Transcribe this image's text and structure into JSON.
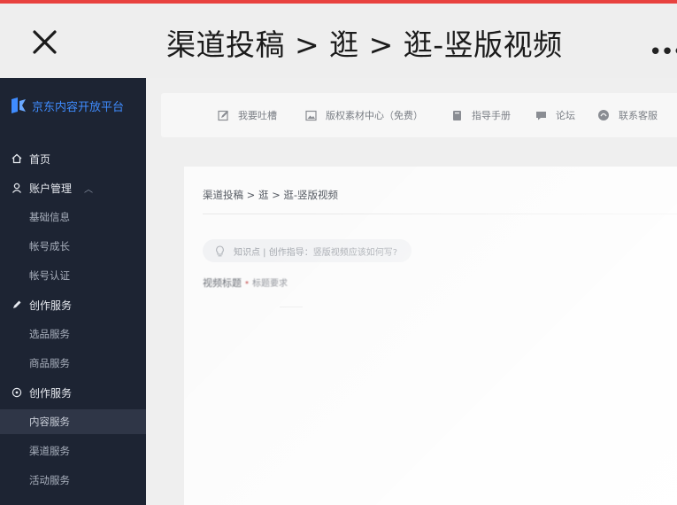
{
  "header": {
    "title": "渠道投稿 > 逛 > 逛-竖版视频",
    "more": "•••"
  },
  "sidebar": {
    "logo_text": "京东内容开放平台",
    "items": [
      {
        "label": "首页",
        "icon": "home-icon",
        "level": 1
      },
      {
        "label": "账户管理",
        "icon": "user-icon",
        "level": 1,
        "expanded": true
      },
      {
        "label": "基础信息",
        "level": 2
      },
      {
        "label": "帐号成长",
        "level": 2
      },
      {
        "label": "帐号认证",
        "level": 2
      },
      {
        "label": "创作服务",
        "icon": "pen-icon",
        "level": 1
      },
      {
        "label": "选品服务",
        "level": 2
      },
      {
        "label": "商品服务",
        "level": 2
      },
      {
        "label": "创作服务",
        "icon": "target-icon",
        "level": 1
      },
      {
        "label": "内容服务",
        "level": 2,
        "active": true
      },
      {
        "label": "渠道服务",
        "level": 2
      },
      {
        "label": "活动服务",
        "level": 2
      }
    ]
  },
  "toolbar": {
    "items": [
      {
        "label": "我要吐槽",
        "icon": "edit-icon"
      },
      {
        "label": "版权素材中心（免费）",
        "icon": "image-icon"
      },
      {
        "label": "指导手册",
        "icon": "book-icon"
      },
      {
        "label": "论坛",
        "icon": "chat-icon"
      },
      {
        "label": "联系客服",
        "icon": "headset-icon"
      }
    ]
  },
  "content": {
    "breadcrumb": "渠道投稿 > 逛 > 逛-竖版视频",
    "tip": "知识点 | 创作指导：竖版视频应该如何写?",
    "field_label": "视频标题",
    "field_required": "*",
    "field_hint": "标题要求"
  },
  "colors": {
    "sidebar_bg": "#1d2433",
    "accent": "#3f8cff",
    "top_accent": "#e8423f"
  }
}
